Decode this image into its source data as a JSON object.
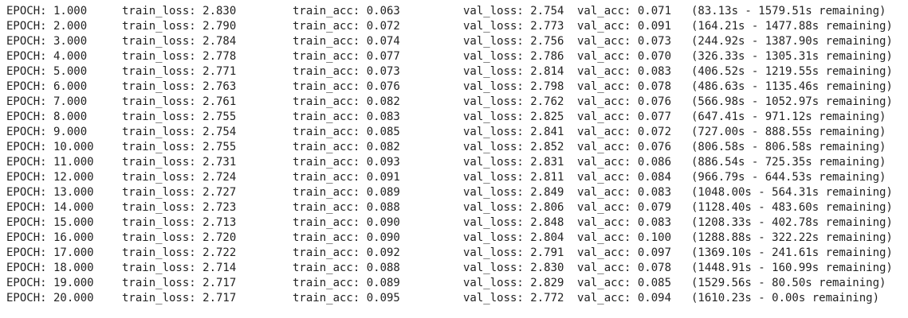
{
  "rows": [
    {
      "epoch": "EPOCH: 1.000",
      "train_loss": "train_loss: 2.830",
      "train_acc": "train_acc: 0.063",
      "val_loss": "val_loss: 2.754",
      "val_acc": "val_acc: 0.071",
      "time": "(83.13s - 1579.51s remaining)"
    },
    {
      "epoch": "EPOCH: 2.000",
      "train_loss": "train_loss: 2.790",
      "train_acc": "train_acc: 0.072",
      "val_loss": "val_loss: 2.773",
      "val_acc": "val_acc: 0.091",
      "time": "(164.21s - 1477.88s remaining)"
    },
    {
      "epoch": "EPOCH: 3.000",
      "train_loss": "train_loss: 2.784",
      "train_acc": "train_acc: 0.074",
      "val_loss": "val_loss: 2.756",
      "val_acc": "val_acc: 0.073",
      "time": "(244.92s - 1387.90s remaining)"
    },
    {
      "epoch": "EPOCH: 4.000",
      "train_loss": "train_loss: 2.778",
      "train_acc": "train_acc: 0.077",
      "val_loss": "val_loss: 2.786",
      "val_acc": "val_acc: 0.070",
      "time": "(326.33s - 1305.31s remaining)"
    },
    {
      "epoch": "EPOCH: 5.000",
      "train_loss": "train_loss: 2.771",
      "train_acc": "train_acc: 0.073",
      "val_loss": "val_loss: 2.814",
      "val_acc": "val_acc: 0.083",
      "time": "(406.52s - 1219.55s remaining)"
    },
    {
      "epoch": "EPOCH: 6.000",
      "train_loss": "train_loss: 2.763",
      "train_acc": "train_acc: 0.076",
      "val_loss": "val_loss: 2.798",
      "val_acc": "val_acc: 0.078",
      "time": "(486.63s - 1135.46s remaining)"
    },
    {
      "epoch": "EPOCH: 7.000",
      "train_loss": "train_loss: 2.761",
      "train_acc": "train_acc: 0.082",
      "val_loss": "val_loss: 2.762",
      "val_acc": "val_acc: 0.076",
      "time": "(566.98s - 1052.97s remaining)"
    },
    {
      "epoch": "EPOCH: 8.000",
      "train_loss": "train_loss: 2.755",
      "train_acc": "train_acc: 0.083",
      "val_loss": "val_loss: 2.825",
      "val_acc": "val_acc: 0.077",
      "time": "(647.41s - 971.12s remaining)"
    },
    {
      "epoch": "EPOCH: 9.000",
      "train_loss": "train_loss: 2.754",
      "train_acc": "train_acc: 0.085",
      "val_loss": "val_loss: 2.841",
      "val_acc": "val_acc: 0.072",
      "time": "(727.00s - 888.55s remaining)"
    },
    {
      "epoch": "EPOCH: 10.000",
      "train_loss": "train_loss: 2.755",
      "train_acc": "train_acc: 0.082",
      "val_loss": "val_loss: 2.852",
      "val_acc": "val_acc: 0.076",
      "time": "(806.58s - 806.58s remaining)"
    },
    {
      "epoch": "EPOCH: 11.000",
      "train_loss": "train_loss: 2.731",
      "train_acc": "train_acc: 0.093",
      "val_loss": "val_loss: 2.831",
      "val_acc": "val_acc: 0.086",
      "time": "(886.54s - 725.35s remaining)"
    },
    {
      "epoch": "EPOCH: 12.000",
      "train_loss": "train_loss: 2.724",
      "train_acc": "train_acc: 0.091",
      "val_loss": "val_loss: 2.811",
      "val_acc": "val_acc: 0.084",
      "time": "(966.79s - 644.53s remaining)"
    },
    {
      "epoch": "EPOCH: 13.000",
      "train_loss": "train_loss: 2.727",
      "train_acc": "train_acc: 0.089",
      "val_loss": "val_loss: 2.849",
      "val_acc": "val_acc: 0.083",
      "time": "(1048.00s - 564.31s remaining)"
    },
    {
      "epoch": "EPOCH: 14.000",
      "train_loss": "train_loss: 2.723",
      "train_acc": "train_acc: 0.088",
      "val_loss": "val_loss: 2.806",
      "val_acc": "val_acc: 0.079",
      "time": "(1128.40s - 483.60s remaining)"
    },
    {
      "epoch": "EPOCH: 15.000",
      "train_loss": "train_loss: 2.713",
      "train_acc": "train_acc: 0.090",
      "val_loss": "val_loss: 2.848",
      "val_acc": "val_acc: 0.083",
      "time": "(1208.33s - 402.78s remaining)"
    },
    {
      "epoch": "EPOCH: 16.000",
      "train_loss": "train_loss: 2.720",
      "train_acc": "train_acc: 0.090",
      "val_loss": "val_loss: 2.804",
      "val_acc": "val_acc: 0.100",
      "time": "(1288.88s - 322.22s remaining)"
    },
    {
      "epoch": "EPOCH: 17.000",
      "train_loss": "train_loss: 2.722",
      "train_acc": "train_acc: 0.092",
      "val_loss": "val_loss: 2.791",
      "val_acc": "val_acc: 0.097",
      "time": "(1369.10s - 241.61s remaining)"
    },
    {
      "epoch": "EPOCH: 18.000",
      "train_loss": "train_loss: 2.714",
      "train_acc": "train_acc: 0.088",
      "val_loss": "val_loss: 2.830",
      "val_acc": "val_acc: 0.078",
      "time": "(1448.91s - 160.99s remaining)"
    },
    {
      "epoch": "EPOCH: 19.000",
      "train_loss": "train_loss: 2.717",
      "train_acc": "train_acc: 0.089",
      "val_loss": "val_loss: 2.829",
      "val_acc": "val_acc: 0.085",
      "time": "(1529.56s - 80.50s remaining)"
    },
    {
      "epoch": "EPOCH: 20.000",
      "train_loss": "train_loss: 2.717",
      "train_acc": "train_acc: 0.095",
      "val_loss": "val_loss: 2.772",
      "val_acc": "val_acc: 0.094",
      "time": "(1610.23s - 0.00s remaining)"
    }
  ]
}
